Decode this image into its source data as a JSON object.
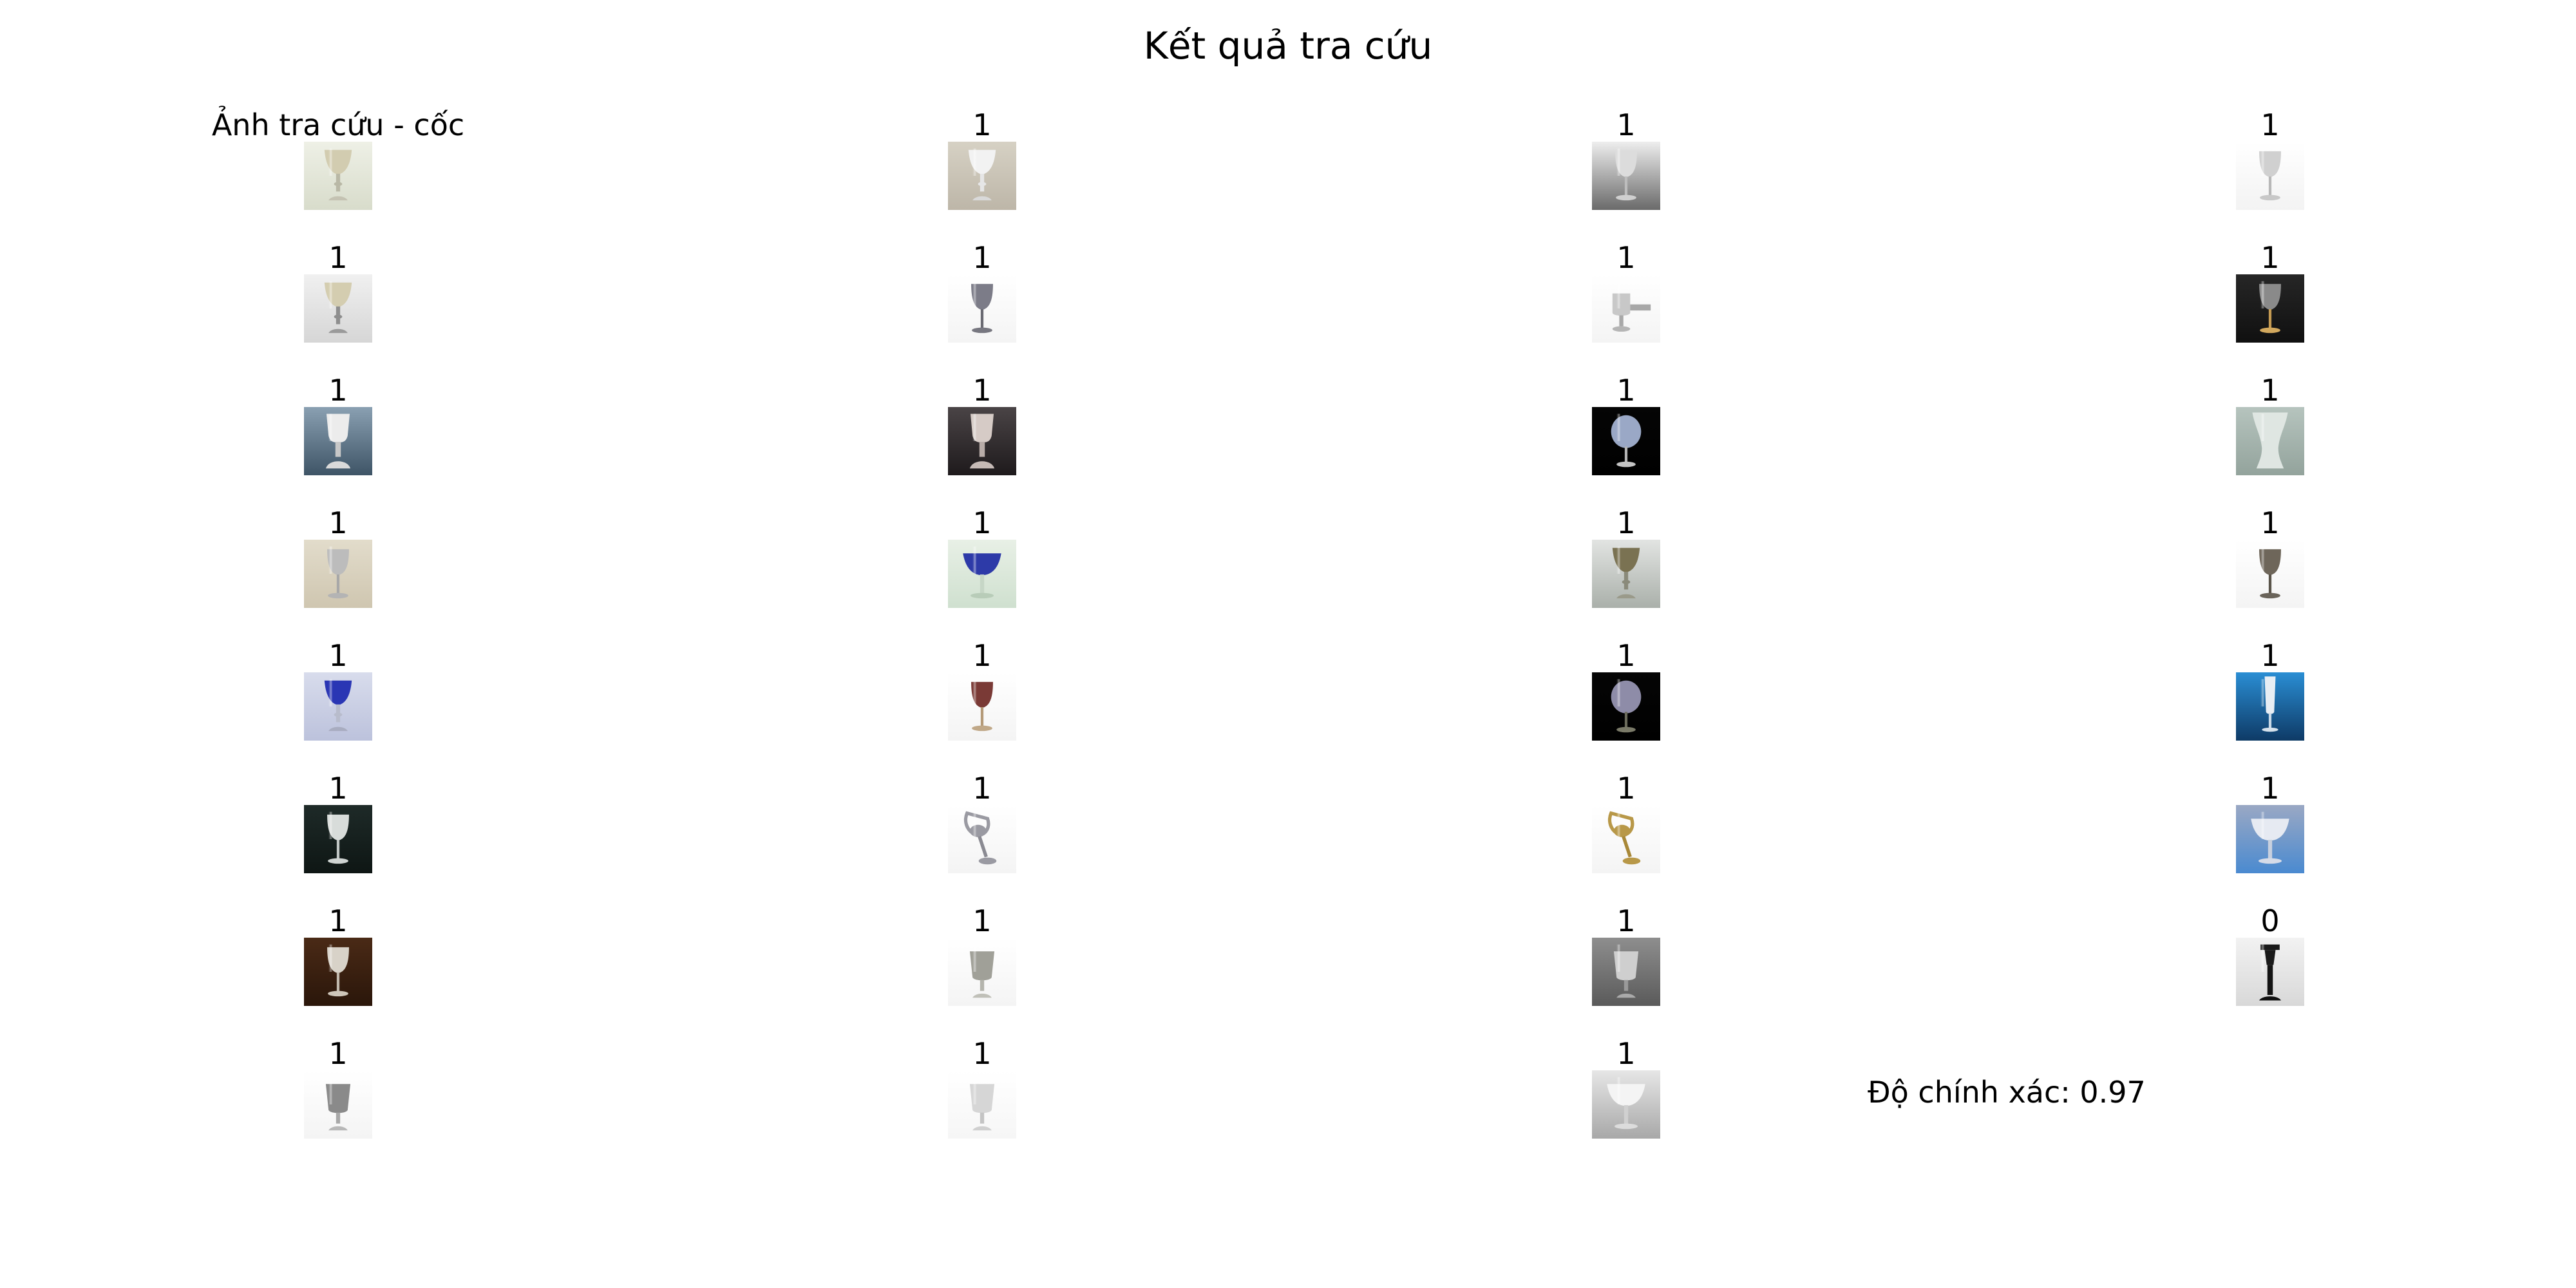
{
  "figure": {
    "title": "Kết quả tra cứu",
    "accuracy_label": "Độ chính xác: 0.97"
  },
  "query": {
    "label": "Ảnh tra cứu - cốc",
    "image": {
      "bg": "#eef0e6",
      "bg2": "#d8dccb",
      "cup": "#d2ccb0",
      "stem": "#b9b8a6",
      "base": "#c4c2b2",
      "shape": "goblet"
    }
  },
  "results": [
    {
      "label": "1",
      "image": {
        "bg": "#d6d1c4",
        "bg2": "#bdb6a8",
        "cup": "#f2f2f2",
        "stem": "#e6e6e6",
        "base": "#d9d9d9",
        "shape": "goblet"
      }
    },
    {
      "label": "1",
      "image": {
        "bg": "#eeeeee",
        "bg2": "#6a6a6a",
        "cup": "#dcdcdc",
        "stem": "#bdbdbd",
        "base": "#cfcfcf",
        "shape": "wine"
      }
    },
    {
      "label": "1",
      "image": {
        "bg": "#ffffff",
        "bg2": "#f3f3f3",
        "cup": "#d0d0d0",
        "stem": "#b8b8b8",
        "base": "#c8c8c8",
        "shape": "wine"
      }
    },
    {
      "label": "1",
      "image": {
        "bg": "#f0f0f0",
        "bg2": "#d6d6d6",
        "cup": "#d4cdb0",
        "stem": "#8e8e8e",
        "base": "#9a9a9a",
        "shape": "goblet"
      }
    },
    {
      "label": "1",
      "image": {
        "bg": "#ffffff",
        "bg2": "#f4f4f4",
        "cup": "#7c7c88",
        "stem": "#6a6a72",
        "base": "#777780",
        "shape": "wine"
      }
    },
    {
      "label": "1",
      "image": {
        "bg": "#ffffff",
        "bg2": "#f4f4f4",
        "cup": "#c8c8c8",
        "stem": "#a8a8a8",
        "base": "#b5b5b5",
        "shape": "tankard"
      }
    },
    {
      "label": "1",
      "image": {
        "bg": "#262626",
        "bg2": "#101010",
        "cup": "#8a8a8a",
        "stem": "#c49a52",
        "base": "#d2a85e",
        "shape": "wine"
      }
    },
    {
      "label": "1",
      "image": {
        "bg": "#8aa0b2",
        "bg2": "#3e5466",
        "cup": "#ececec",
        "stem": "#c8c8c8",
        "base": "#dadada",
        "shape": "chalice"
      }
    },
    {
      "label": "1",
      "image": {
        "bg": "#4a4446",
        "bg2": "#1e1a1c",
        "cup": "#d6cbc6",
        "stem": "#b8aca8",
        "base": "#c6bab6",
        "shape": "chalice"
      }
    },
    {
      "label": "1",
      "image": {
        "bg": "#050505",
        "bg2": "#000000",
        "cup": "#9aa8c6",
        "stem": "#b4b4b4",
        "base": "#c4c4c4",
        "shape": "balloon"
      }
    },
    {
      "label": "1",
      "image": {
        "bg": "#b6c4be",
        "bg2": "#93a39c",
        "cup": "#dfe6e2",
        "stem": "#c9d1cd",
        "base": "#d5dbd8",
        "shape": "vase"
      }
    },
    {
      "label": "1",
      "image": {
        "bg": "#e2dccb",
        "bg2": "#cfc6b0",
        "cup": "#bcbcbc",
        "stem": "#a8a8a8",
        "base": "#b4b4b4",
        "shape": "wine"
      }
    },
    {
      "label": "1",
      "image": {
        "bg": "#e8f0e6",
        "bg2": "#cfe0cf",
        "cup": "#2d3aa8",
        "stem": "#c6d6c6",
        "base": "#b8ccb8",
        "shape": "coupe"
      }
    },
    {
      "label": "1",
      "image": {
        "bg": "#e2e4e2",
        "bg2": "#aab0aa",
        "cup": "#7a7252",
        "stem": "#8a8a7a",
        "base": "#9a9a8a",
        "shape": "goblet"
      }
    },
    {
      "label": "1",
      "image": {
        "bg": "#ffffff",
        "bg2": "#f4f4f4",
        "cup": "#6e665a",
        "stem": "#5a544a",
        "base": "#6a645a",
        "shape": "wine"
      }
    },
    {
      "label": "1",
      "image": {
        "bg": "#d8dcec",
        "bg2": "#bcc2dc",
        "cup": "#2a36b4",
        "stem": "#b8bccc",
        "base": "#a8acc0",
        "shape": "goblet"
      }
    },
    {
      "label": "1",
      "image": {
        "bg": "#ffffff",
        "bg2": "#f4f4f4",
        "cup": "#7a3a36",
        "stem": "#b49a78",
        "base": "#c0a888",
        "shape": "wine"
      }
    },
    {
      "label": "1",
      "image": {
        "bg": "#050505",
        "bg2": "#000000",
        "cup": "#8e8ca8",
        "stem": "#6a6a5a",
        "base": "#7a7a68",
        "shape": "balloon"
      }
    },
    {
      "label": "1",
      "image": {
        "bg": "#2a8ed4",
        "bg2": "#0e3a66",
        "cup": "#e8eef4",
        "stem": "#c8d8e6",
        "base": "#d6e2ec",
        "shape": "flute"
      }
    },
    {
      "label": "1",
      "image": {
        "bg": "#1e2a28",
        "bg2": "#0e1614",
        "cup": "#d8dcda",
        "stem": "#c0c6c4",
        "base": "#cfd4d2",
        "shape": "wine"
      }
    },
    {
      "label": "1",
      "image": {
        "bg": "#ffffff",
        "bg2": "#f4f4f4",
        "cup": "#9a9aa2",
        "stem": "#8a8a92",
        "base": "#9a9aa2",
        "shape": "tilted"
      }
    },
    {
      "label": "1",
      "image": {
        "bg": "#ffffff",
        "bg2": "#f4f4f4",
        "cup": "#b89848",
        "stem": "#a88838",
        "base": "#b89848",
        "shape": "tilted"
      }
    },
    {
      "label": "1",
      "image": {
        "bg": "#9aa8c4",
        "bg2": "#4a8ad0",
        "cup": "#e6eaf2",
        "stem": "#c8d0de",
        "base": "#d6dce8",
        "shape": "coupe"
      }
    },
    {
      "label": "1",
      "image": {
        "bg": "#4a2a16",
        "bg2": "#2a160a",
        "cup": "#d8d2c8",
        "stem": "#c0b8ac",
        "base": "#cec6ba",
        "shape": "wine"
      }
    },
    {
      "label": "1",
      "image": {
        "bg": "#ffffff",
        "bg2": "#f4f4f4",
        "cup": "#a0a098",
        "stem": "#b4b4ac",
        "base": "#c0c0b8",
        "shape": "tumbler"
      }
    },
    {
      "label": "1",
      "image": {
        "bg": "#8e8e8e",
        "bg2": "#5a5a5a",
        "cup": "#cfcfcf",
        "stem": "#9a9a9a",
        "base": "#aaaaaa",
        "shape": "tumbler"
      }
    },
    {
      "label": "0",
      "image": {
        "bg": "#f2f2f2",
        "bg2": "#d8d8d8",
        "cup": "#1a1a1a",
        "stem": "#141414",
        "base": "#101010",
        "shape": "pillar"
      }
    },
    {
      "label": "1",
      "image": {
        "bg": "#ffffff",
        "bg2": "#f4f4f4",
        "cup": "#8a8a8a",
        "stem": "#a8a8a8",
        "base": "#b8b8b8",
        "shape": "tumbler"
      }
    },
    {
      "label": "1",
      "image": {
        "bg": "#ffffff",
        "bg2": "#f6f6f6",
        "cup": "#d6d6d6",
        "stem": "#c4c4c4",
        "base": "#d0d0d0",
        "shape": "tumbler"
      }
    },
    {
      "label": "1",
      "image": {
        "bg": "#e6e6e6",
        "bg2": "#a8a8a8",
        "cup": "#f4f4f4",
        "stem": "#d0d0d0",
        "base": "#dcdcdc",
        "shape": "coupe"
      }
    }
  ]
}
